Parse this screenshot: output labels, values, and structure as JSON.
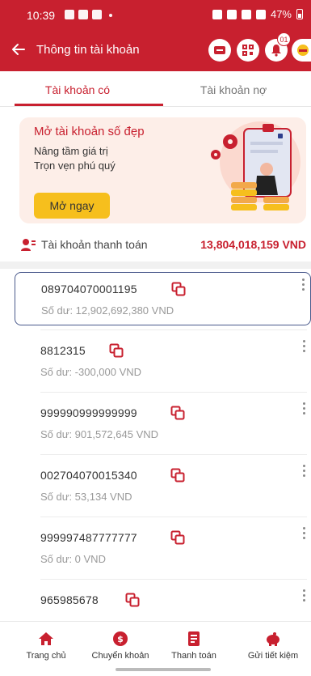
{
  "status_bar": {
    "time": "10:39",
    "battery": "47%"
  },
  "header": {
    "title": "Thông tin tài khoản",
    "notification_count": "01"
  },
  "tabs": {
    "credit": "Tài khoản có",
    "debit": "Tài khoản nợ"
  },
  "promo": {
    "title": "Mở tài khoản số đẹp",
    "line1": "Nâng tầm giá trị",
    "line2": "Trọn vẹn phú quý",
    "button": "Mở ngay"
  },
  "payment": {
    "label": "Tài khoản thanh toán",
    "total": "13,804,018,159 VND"
  },
  "accounts": [
    {
      "number": "089704070001195",
      "balance": "Số dư: 12,902,692,380 VND"
    },
    {
      "number": "8812315",
      "balance": "Số dư: -300,000 VND"
    },
    {
      "number": "999990999999999",
      "balance": "Số dư: 901,572,645 VND"
    },
    {
      "number": "002704070015340",
      "balance": "Số dư: 53,134 VND"
    },
    {
      "number": "999997487777777",
      "balance": "Số dư: 0 VND"
    },
    {
      "number": "965985678",
      "balance": ""
    }
  ],
  "bottom_nav": [
    {
      "label": "Trang chủ",
      "icon": "home-icon"
    },
    {
      "label": "Chuyển khoản",
      "icon": "transfer-icon"
    },
    {
      "label": "Thanh toán",
      "icon": "bill-icon"
    },
    {
      "label": "Gửi tiết kiệm",
      "icon": "piggy-bank-icon"
    }
  ],
  "colors": {
    "brand_red": "#c8202f",
    "button_yellow": "#f6bf1d",
    "selected_border": "#4a5a8c"
  }
}
